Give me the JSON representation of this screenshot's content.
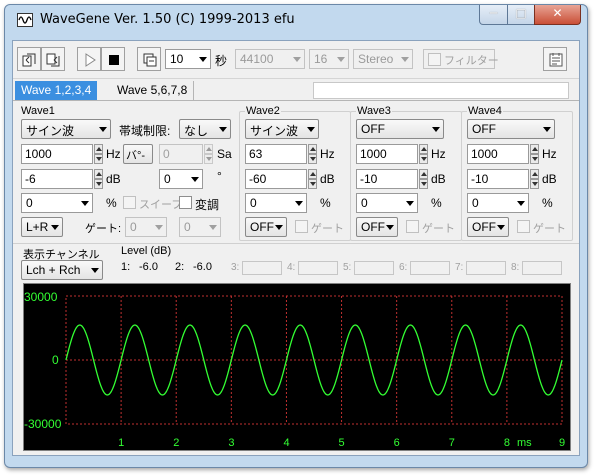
{
  "window": {
    "title": "WaveGene  Ver. 1.50  (C) 1999-2013 efu",
    "controls": {
      "minimize": "─",
      "maximize": "□",
      "close": "✕"
    }
  },
  "toolbar": {
    "duration_value": "10",
    "duration_unit": "秒",
    "sample_rate": "44100",
    "bit_depth": "16",
    "channel_mode": "Stereo",
    "filter_label": "フィルター"
  },
  "tabs": [
    {
      "label": "Wave 1,2,3,4"
    },
    {
      "label": "Wave 5,6,7,8"
    }
  ],
  "wave1": {
    "name": "Wave1",
    "waveform": "サイン波",
    "band_limit_label": "帯域制限:",
    "band_limit_value": "なし",
    "freq_value": "1000",
    "freq_unit": "Hz",
    "burst_label": "バ°-",
    "burst_value": "0",
    "burst_unit": "Sa",
    "level_value": "-6",
    "level_unit": "dB",
    "phase_value": "0",
    "phase_unit": "°",
    "dc_value": "0",
    "dc_unit": "%",
    "sweep_label": "スイープ",
    "mod_label": "変調",
    "route": "L+R",
    "gate_label": "ゲート:",
    "gate_on": "0",
    "gate_off": "0"
  },
  "wave2": {
    "name": "Wave2",
    "waveform": "サイン波",
    "freq_value": "63",
    "freq_unit": "Hz",
    "level_value": "-60",
    "level_unit": "dB",
    "dc_value": "0",
    "dc_unit": "%",
    "route": "OFF",
    "gate_label": "ゲート"
  },
  "wave3": {
    "name": "Wave3",
    "waveform": "OFF",
    "freq_value": "1000",
    "freq_unit": "Hz",
    "level_value": "-10",
    "level_unit": "dB",
    "dc_value": "0",
    "dc_unit": "%",
    "route": "OFF",
    "gate_label": "ゲート"
  },
  "wave4": {
    "name": "Wave4",
    "waveform": "OFF",
    "freq_value": "1000",
    "freq_unit": "Hz",
    "level_value": "-10",
    "level_unit": "dB",
    "dc_value": "0",
    "dc_unit": "%",
    "route": "OFF",
    "gate_label": "ゲート"
  },
  "display": {
    "channel_label": "表示チャンネル",
    "channel_value": "Lch + Rch",
    "level_header": "Level (dB)",
    "levels": [
      {
        "ch": "1:",
        "value": "-6.0"
      },
      {
        "ch": "2:",
        "value": "-6.0"
      },
      {
        "ch": "3:",
        "value": ""
      },
      {
        "ch": "4:",
        "value": ""
      },
      {
        "ch": "5:",
        "value": ""
      },
      {
        "ch": "6:",
        "value": ""
      },
      {
        "ch": "7:",
        "value": ""
      },
      {
        "ch": "8:",
        "value": ""
      }
    ]
  },
  "scope": {
    "trace_color": "#33ff33",
    "grid_color": "#c03030",
    "background": "#000000"
  },
  "chart_data": {
    "type": "line",
    "title": "",
    "xlabel": "ms",
    "ylabel": "",
    "xlim": [
      0,
      9
    ],
    "ylim": [
      -30000,
      30000
    ],
    "yticks": [
      "30000",
      "0",
      "-30000"
    ],
    "xticks": [
      "1",
      "2",
      "3",
      "4",
      "5",
      "6",
      "7",
      "8",
      "9"
    ],
    "grid": true,
    "series": [
      {
        "amplitude": 16384,
        "frequency_hz": 1000,
        "x_start": 0,
        "x_end": 9
      }
    ]
  }
}
